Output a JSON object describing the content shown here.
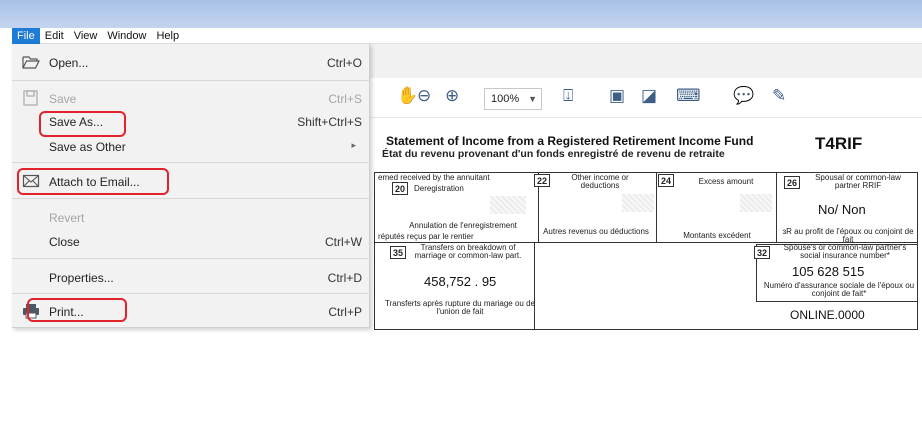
{
  "menubar": {
    "items": [
      "File",
      "Edit",
      "View",
      "Window",
      "Help"
    ],
    "active": "File"
  },
  "file_menu": {
    "open": {
      "label": "Open...",
      "shortcut": "Ctrl+O"
    },
    "save": {
      "label": "Save",
      "shortcut": "Ctrl+S"
    },
    "save_as": {
      "label": "Save As...",
      "shortcut": "Shift+Ctrl+S"
    },
    "save_as_other": {
      "label": "Save as Other"
    },
    "attach_to_email": {
      "label": "Attach to Email..."
    },
    "revert": {
      "label": "Revert"
    },
    "close": {
      "label": "Close",
      "shortcut": "Ctrl+W"
    },
    "properties": {
      "label": "Properties...",
      "shortcut": "Ctrl+D"
    },
    "print": {
      "label": "Print...",
      "shortcut": "Ctrl+P"
    }
  },
  "toolbar": {
    "zoom": "100%"
  },
  "document": {
    "title": "Statement of Income from a Registered Retirement Income Fund",
    "subtitle": "État du revenu provenant d'un fonds enregistré de revenu de retraite",
    "form_code": "T4RIF",
    "boxes": {
      "b20_num": "20",
      "b20_label": "Deregistration",
      "b20_fr": "Annulation de l'enregistrement",
      "top_left_label": "emed received by the annuitant",
      "bottom_left_label": "réputés reçus par le rentier",
      "b22_num": "22",
      "b22_label": "Other income or deductions",
      "b22_fr": "Autres revenus ou déductions",
      "b24_num": "24",
      "b24_label": "Excess amount",
      "b24_fr": "Montants excédent",
      "b26_num": "26",
      "b26_label": "Spousal or common-law partner RRIF",
      "b26_value": "No/ Non",
      "b26_fr": "ɜR au profit de l'époux ou conjoint de fait",
      "b35_num": "35",
      "b35_label": "Transfers on breakdown of marriage or common-law part.",
      "b35_value": "458,752 . 95",
      "b35_fr": "Transferts après rupture du mariage ou de l'union de fait",
      "b32_num": "32",
      "b32_label": "Spouse's or common-law partner's social insurance number*",
      "b32_value": "105 628 515",
      "b32_fr": "Numéro d'assurance sociale de l'époux ou conjoint de fait*",
      "footer": "ONLINE.0000"
    }
  }
}
